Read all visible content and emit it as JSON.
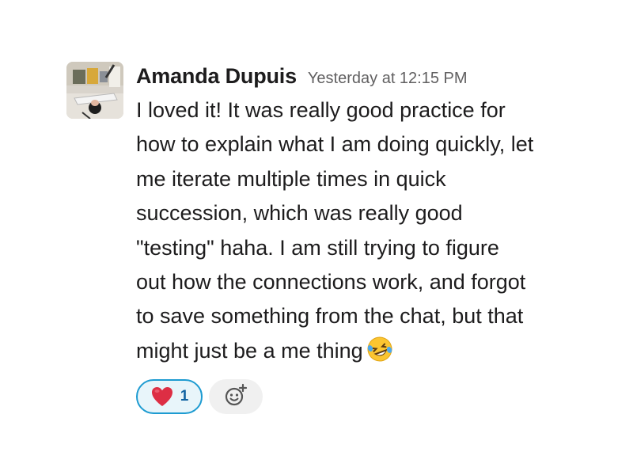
{
  "message": {
    "author": "Amanda Dupuis",
    "timestamp": "Yesterday at 12:15 PM",
    "text": "I loved it! It was really good practice for\nhow to explain what I am doing quickly, let\nme iterate multiple times in quick\nsuccession, which was really good\n\"testing\" haha. I am still trying to figure\nout how the connections work, and forgot\nto save something from the chat, but that\nmight just be a me thing",
    "trailing_emoji": "rolling-on-floor-laughing-emoji"
  },
  "reactions": [
    {
      "emoji": "red-heart-emoji",
      "count": "1",
      "selected": true
    }
  ],
  "add_reaction_icon": "add-reaction-icon",
  "colors": {
    "reaction_border": "#1d9bd1",
    "reaction_bg": "#e8f5fa",
    "reaction_count": "#1264a3",
    "timestamp": "#616061"
  }
}
